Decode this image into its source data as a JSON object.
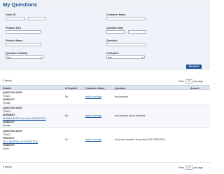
{
  "page": {
    "title": "My Questions"
  },
  "filters": {
    "order_id_label": "Order ID",
    "customer_name_label": "Customer Name",
    "product_sku_label": "Product SKU",
    "question_date_label": "Question Date",
    "product_name_label": "Product Name",
    "question_label": "Question",
    "question_visibility_label": "Question Visibility",
    "question_visibility_value": "Any",
    "is_replied_label": "Is Replied",
    "is_replied_value": "Any",
    "range_dash": "–"
  },
  "search_button": "SEARCH",
  "results": {
    "count_top": "3 item(s)",
    "count_bottom": "3 item(s)",
    "show_label": "Show",
    "per_page": "10",
    "per_page_suffix": "per page"
  },
  "table": {
    "headers": {
      "details": "Details",
      "is_replied": "Is Replied",
      "customer_name": "Customer Name",
      "question": "Question",
      "answer": "Answer"
    },
    "rows": [
      {
        "lines": [
          "QUESTION DATE",
          "7/18/13",
          "VISIBILITY",
          "Private"
        ],
        "is_replied": "No",
        "customer_name": "test do not ship",
        "question": "test question"
      },
      {
        "lines": [
          "QUESTION DATE",
          "7/18/13",
          "SHIPMENT",
          "#1000001125 2-3 for order #1000001125",
          "VISIBILITY",
          "Private"
        ],
        "is_replied": "No",
        "customer_name": "test do not ship",
        "question": "test question about shipment"
      },
      {
        "lines": [
          "QUESTION DATE",
          "7/18/13",
          "PRODUCT",
          "SKU: 8523PDA_AT&T 8525 PDA",
          "VISIBILITY",
          "Public"
        ],
        "is_replied": "No",
        "customer_name": "test do not ship",
        "question": "test public question for product AT&T 8525 PDA"
      }
    ]
  },
  "colors": {
    "accent": "#1d4d8f",
    "title": "#1e4f8c",
    "link": "#1e5aa8",
    "filter_bg": "#eef3f9",
    "header_bg": "#dde4ec"
  }
}
